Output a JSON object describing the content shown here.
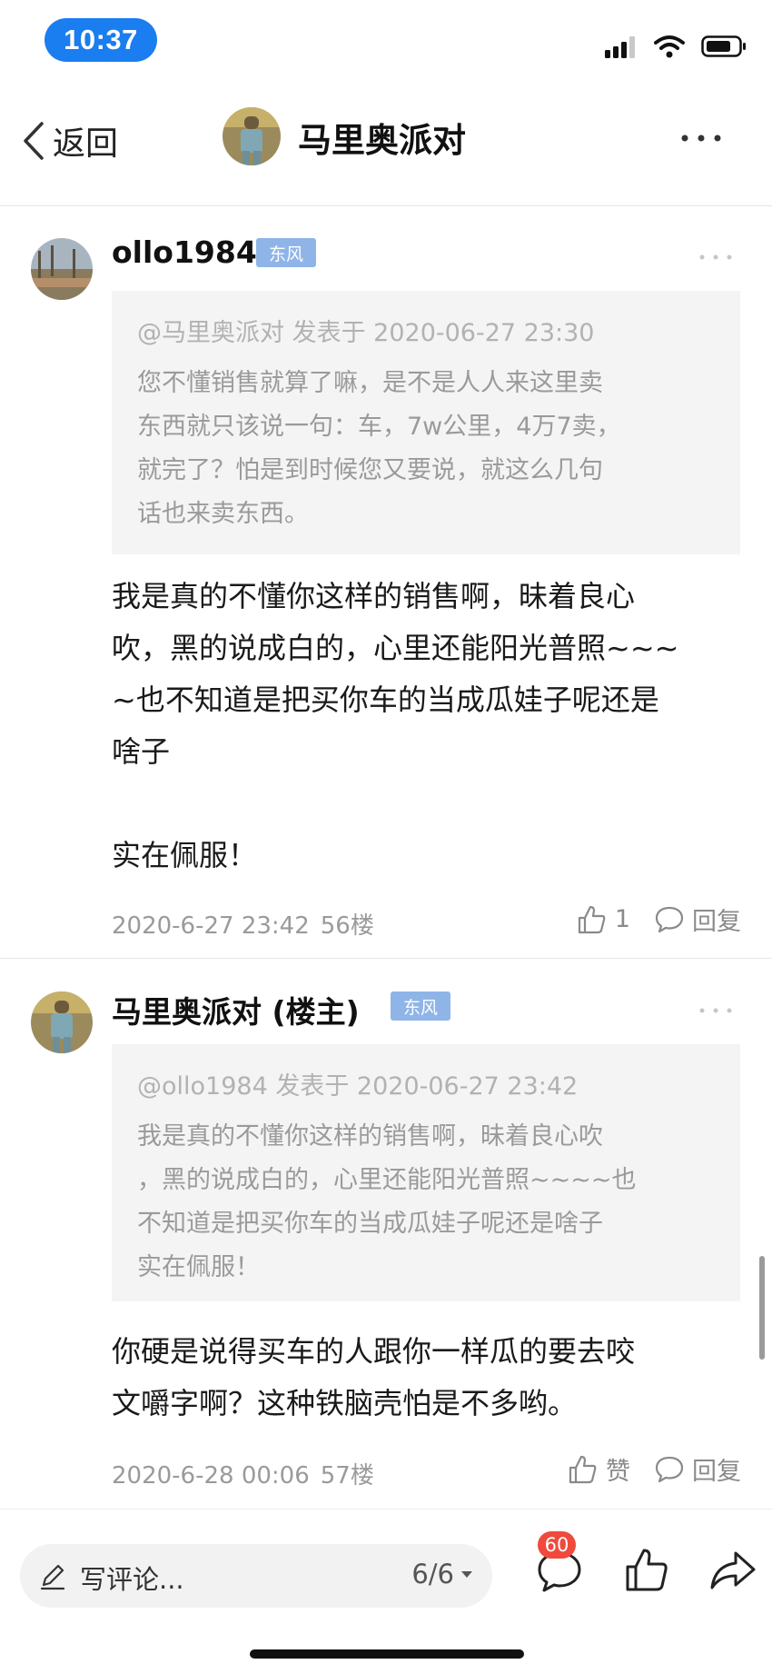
{
  "status_bar": {
    "time": "10:37"
  },
  "nav": {
    "back_label": "返回",
    "title": "马里奥派对"
  },
  "posts": [
    {
      "username": "ollo1984",
      "badge": "东风",
      "quote_head": "@马里奥派对 发表于 2020-06-27 23:30",
      "quote_body": "您不懂销售就算了嘛，是不是人人来这里卖\n东西就只该说一句：车，7w公里，4万7卖，\n就完了？怕是到时候您又要说，就这么几句\n话也来卖东西。",
      "body": "我是真的不懂你这样的销售啊，昧着良心\n吹，黑的说成白的，心里还能阳光普照~~~\n~也不知道是把买你车的当成瓜娃子呢还是\n啥子\n\n实在佩服！",
      "date": "2020-6-27 23:42",
      "floor": "56楼",
      "likes": "1",
      "reply_label": "回复"
    },
    {
      "username": "马里奥派对 (楼主)",
      "badge": "东风",
      "quote_head": "@ollo1984 发表于 2020-06-27 23:42",
      "quote_body": "我是真的不懂你这样的销售啊，昧着良心吹\n，黑的说成白的，心里还能阳光普照~~~~也\n不知道是把买你车的当成瓜娃子呢还是啥子\n实在佩服！",
      "body": "你硬是说得买车的人跟你一样瓜的要去咬\n文嚼字啊？这种铁脑壳怕是不多哟。",
      "date": "2020-6-28 00:06",
      "floor": "57楼",
      "likes": "赞",
      "reply_label": "回复"
    }
  ],
  "bottom_bar": {
    "comment_placeholder": "写评论...",
    "page_indicator": "6/6",
    "comment_count": "60"
  },
  "colors": {
    "accent": "#1a7df0",
    "badge": "#8fb5e8",
    "notification": "#f04a3c"
  },
  "icons": [
    "signal-icon",
    "wifi-icon",
    "battery-icon",
    "back-arrow-icon",
    "more-icon",
    "like-icon",
    "reply-icon",
    "pencil-icon",
    "caret-down-icon",
    "comment-icon",
    "thumbs-up-icon",
    "share-icon"
  ]
}
